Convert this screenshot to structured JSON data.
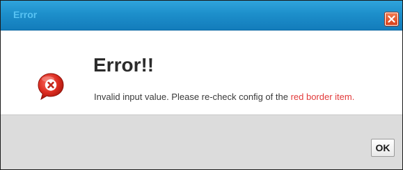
{
  "dialog": {
    "title": "Error",
    "close_icon": "close-icon",
    "status_icon": "error-icon",
    "heading": "Error!!",
    "message": "Invalid input value. Please re-check config of the ",
    "message_highlight": "red border item.",
    "ok_label": "OK"
  },
  "colors": {
    "title_bar": "#1d8fcb",
    "highlight_text": "#e23a3a",
    "close_button": "#d8401a",
    "footer": "#dcdcdc"
  }
}
